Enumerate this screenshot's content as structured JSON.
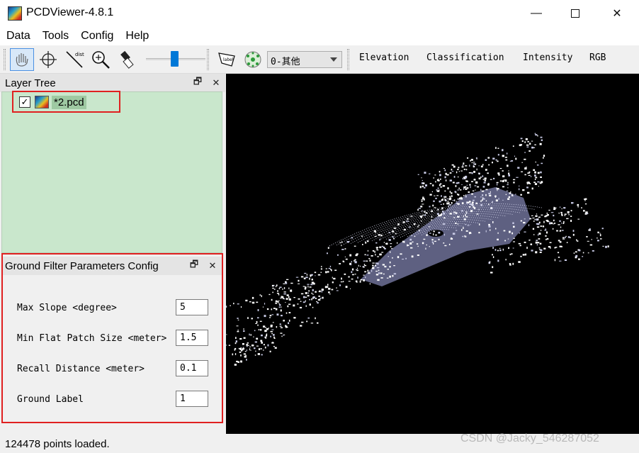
{
  "window": {
    "title": "PCDViewer-4.8.1",
    "minimize": "—",
    "close": "✕"
  },
  "menu": [
    "Data",
    "Tools",
    "Config",
    "Help"
  ],
  "toolbar": {
    "combo_value": "0-其他",
    "color_modes": [
      "Elevation",
      "Classification",
      "Intensity",
      "RGB"
    ],
    "label_tool_text": "label",
    "dist_tool_text": "dist"
  },
  "layer_tree": {
    "title": "Layer Tree",
    "float_icon": "🗗",
    "close_icon": "✕",
    "items": [
      {
        "name": "*2.pcd",
        "checked": true,
        "check_mark": "✓"
      }
    ]
  },
  "ground_filter": {
    "title": "Ground Filter Parameters Config",
    "float_icon": "🗗",
    "close_icon": "✕",
    "params": [
      {
        "label": "Max Slope <degree>",
        "value": "5"
      },
      {
        "label": "Min Flat Patch Size <meter>",
        "value": "1.5"
      },
      {
        "label": "Recall Distance <meter>",
        "value": "0.1"
      },
      {
        "label": "Ground Label",
        "value": "1"
      }
    ]
  },
  "status": {
    "text": "124478 points loaded."
  },
  "watermark": "CSDN @Jacky_546287052",
  "colors": {
    "layer_bg": "#c9e7cc",
    "selection": "#9ec9a2",
    "highlight_box": "#e02020",
    "slider": "#0078d7",
    "ground_points": "#7b7fb0"
  }
}
